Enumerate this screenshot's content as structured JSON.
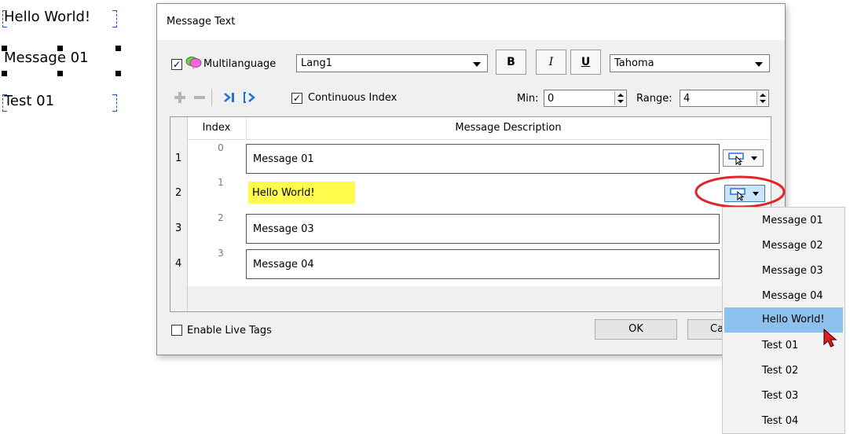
{
  "canvas": {
    "objects": [
      "Hello World!",
      "Message 01",
      "Test 01"
    ]
  },
  "dialog": {
    "title": "Message Text",
    "multilanguage_label": "Multilanguage",
    "multilanguage_checked": true,
    "language_value": "Lang1",
    "bold_label": "B",
    "italic_label": "I",
    "underline_label": "U",
    "font_value": "Tahoma",
    "continuous_index_label": "Continuous Index",
    "continuous_index_checked": true,
    "min_label": "Min:",
    "min_value": "0",
    "range_label": "Range:",
    "range_value": "4",
    "table": {
      "columns": [
        "Index",
        "Message Description"
      ],
      "rows": [
        {
          "num": "1",
          "index": "0",
          "description": "Message 01"
        },
        {
          "num": "2",
          "index": "1",
          "description": "Hello World!"
        },
        {
          "num": "3",
          "index": "2",
          "description": "Message 03"
        },
        {
          "num": "4",
          "index": "3",
          "description": "Message 04"
        }
      ]
    },
    "enable_live_tags_label": "Enable Live Tags",
    "enable_live_tags_checked": false,
    "ok_label": "OK",
    "cancel_label": "Ca"
  },
  "dropdown": {
    "items": [
      "Message 01",
      "Message 02",
      "Message 03",
      "Message 04",
      "Hello World!",
      "Test 01",
      "Test 02",
      "Test 03",
      "Test 04"
    ],
    "selected": "Hello World!"
  },
  "colors": {
    "highlight": "#fffb4d",
    "menu_selected": "#8ec0ee",
    "callout_circle": "#e0262a",
    "accent_blue": "#1e73d9"
  }
}
